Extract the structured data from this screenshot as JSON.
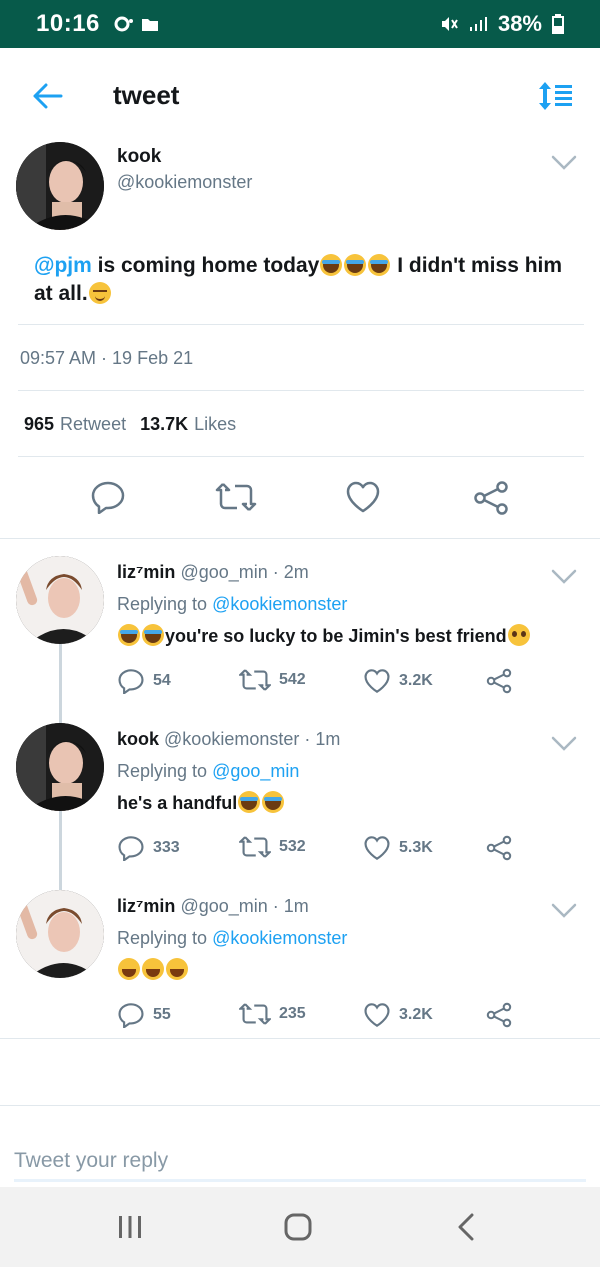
{
  "status_bar": {
    "time": "10:16",
    "battery": "38%"
  },
  "header": {
    "title": "tweet"
  },
  "main_tweet": {
    "name": "kook",
    "handle": "@kookiemonster",
    "mention": "@pjm",
    "text_a": " is coming home today",
    "text_b": " I didn't miss him at all.",
    "timestamp": "09:57 AM · 19 Feb 21",
    "retweet_count": "965",
    "retweet_label": "Retweet",
    "likes_count": "13.7K",
    "likes_label": "Likes"
  },
  "replies": [
    {
      "name": "liz⁷min",
      "handle": "@goo_min",
      "age": " · 2m",
      "replying_label": "Replying to ",
      "replying_to": "@kookiemonster",
      "text": "you're so lucky to be Jimin's best friend",
      "replies": "54",
      "retweets": "542",
      "likes": "3.2K"
    },
    {
      "name": "kook",
      "handle": "@kookiemonster",
      "age": " · 1m",
      "replying_label": "Replying to ",
      "replying_to": "@goo_min",
      "text": "he's a handful",
      "replies": "333",
      "retweets": "532",
      "likes": "5.3K"
    },
    {
      "name": "liz⁷min",
      "handle": "@goo_min",
      "age": " · 1m",
      "replying_label": "Replying to ",
      "replying_to": "@kookiemonster",
      "text": "",
      "replies": "55",
      "retweets": "235",
      "likes": "3.2K"
    }
  ],
  "compose": {
    "placeholder": "Tweet your reply"
  },
  "colors": {
    "status_bar": "#075a4a",
    "accent": "#1da1f2",
    "muted": "#657786"
  }
}
